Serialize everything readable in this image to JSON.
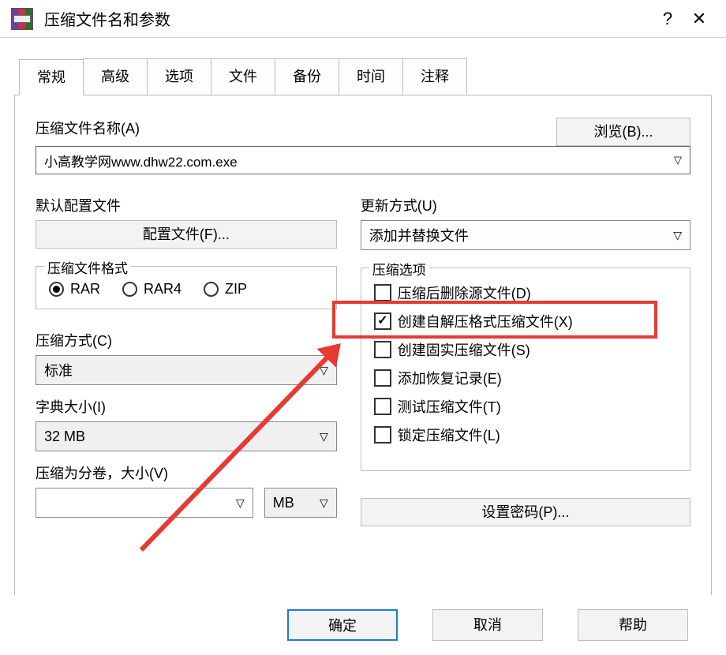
{
  "window": {
    "title": "压缩文件名和参数"
  },
  "tabs": {
    "general": "常规",
    "advanced": "高级",
    "options": "选项",
    "file": "文件",
    "backup": "备份",
    "time": "时间",
    "comment": "注释"
  },
  "filename": {
    "label": "压缩文件名称(A)",
    "value": "小高教学网www.dhw22.com.exe",
    "browse": "浏览(B)..."
  },
  "default_profile": {
    "label": "默认配置文件",
    "button": "配置文件(F)..."
  },
  "update_mode": {
    "label": "更新方式(U)",
    "value": "添加并替换文件"
  },
  "format": {
    "legend": "压缩文件格式",
    "rar": "RAR",
    "rar4": "RAR4",
    "zip": "ZIP"
  },
  "compression": {
    "label": "压缩方式(C)",
    "value": "标准"
  },
  "dictionary": {
    "label": "字典大小(I)",
    "value": "32 MB"
  },
  "split": {
    "label": "压缩为分卷，大小(V)",
    "unit": "MB"
  },
  "options": {
    "legend": "压缩选项",
    "delete_after": "压缩后删除源文件(D)",
    "create_sfx": "创建自解压格式压缩文件(X)",
    "solid": "创建固实压缩文件(S)",
    "recovery": "添加恢复记录(E)",
    "test": "测试压缩文件(T)",
    "lock": "锁定压缩文件(L)"
  },
  "password_button": "设置密码(P)...",
  "footer": {
    "ok": "确定",
    "cancel": "取消",
    "help": "帮助"
  }
}
